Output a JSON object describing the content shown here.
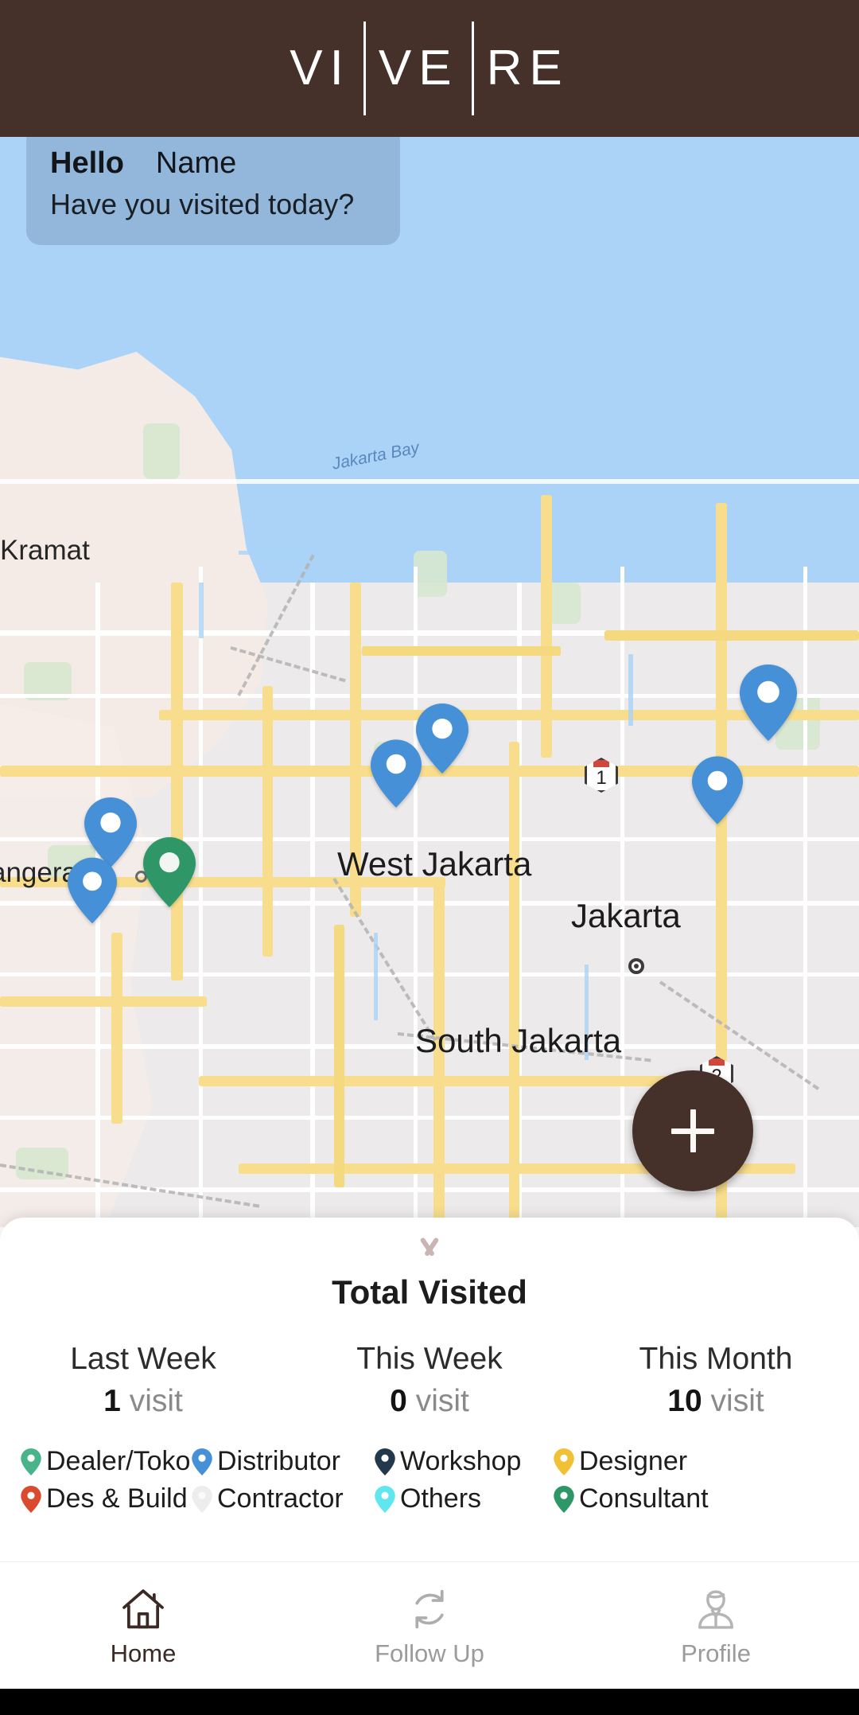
{
  "header": {
    "logo_parts": [
      "VI",
      "VE",
      "RE"
    ]
  },
  "greeting": {
    "hello": "Hello",
    "name": "Name",
    "question": "Have you visited today?"
  },
  "map": {
    "labels": [
      {
        "text": "Kramat",
        "kind": "town"
      },
      {
        "text": "Jakarta Bay",
        "kind": "bay"
      },
      {
        "text": "angerang",
        "kind": "town"
      },
      {
        "text": "West Jakarta",
        "kind": "city"
      },
      {
        "text": "Jakarta",
        "kind": "city"
      },
      {
        "text": "South Jakarta",
        "kind": "city"
      }
    ],
    "highway_shields": [
      "1",
      "2"
    ],
    "markers": [
      {
        "type": "Distributor",
        "color": "#4690d8"
      },
      {
        "type": "Distributor",
        "color": "#4690d8"
      },
      {
        "type": "Distributor",
        "color": "#4690d8"
      },
      {
        "type": "Distributor",
        "color": "#4690d8"
      },
      {
        "type": "Distributor",
        "color": "#4690d8"
      },
      {
        "type": "Distributor",
        "color": "#4690d8"
      },
      {
        "type": "Consultant",
        "color": "#2f9668"
      }
    ]
  },
  "fab": {
    "label": "+",
    "color": "#46302a"
  },
  "sheet": {
    "title": "Total Visited",
    "stats": [
      {
        "label": "Last Week",
        "value": "1",
        "unit": "visit"
      },
      {
        "label": "This Week",
        "value": "0",
        "unit": "visit"
      },
      {
        "label": "This Month",
        "value": "10",
        "unit": "visit"
      }
    ],
    "legend": [
      {
        "label": "Dealer/Toko",
        "color": "#49b48b"
      },
      {
        "label": "Distributor",
        "color": "#4690d8"
      },
      {
        "label": "Workshop",
        "color": "#23384b"
      },
      {
        "label": "Designer",
        "color": "#f0c135"
      },
      {
        "label": "Des & Build",
        "color": "#da4a2e"
      },
      {
        "label": "Contractor",
        "color": "#ededed"
      },
      {
        "label": "Others",
        "color": "#5fe6ee"
      },
      {
        "label": "Consultant",
        "color": "#2f9668"
      }
    ]
  },
  "nav": {
    "items": [
      {
        "label": "Home",
        "icon": "home-icon",
        "active": true
      },
      {
        "label": "Follow Up",
        "icon": "refresh-icon",
        "active": false
      },
      {
        "label": "Profile",
        "icon": "person-icon",
        "active": false
      }
    ]
  },
  "colors": {
    "brand_brown": "#46302a",
    "map_water": "#aad3f7",
    "map_land": "#eceaea",
    "map_road": "#f7dd8c"
  }
}
